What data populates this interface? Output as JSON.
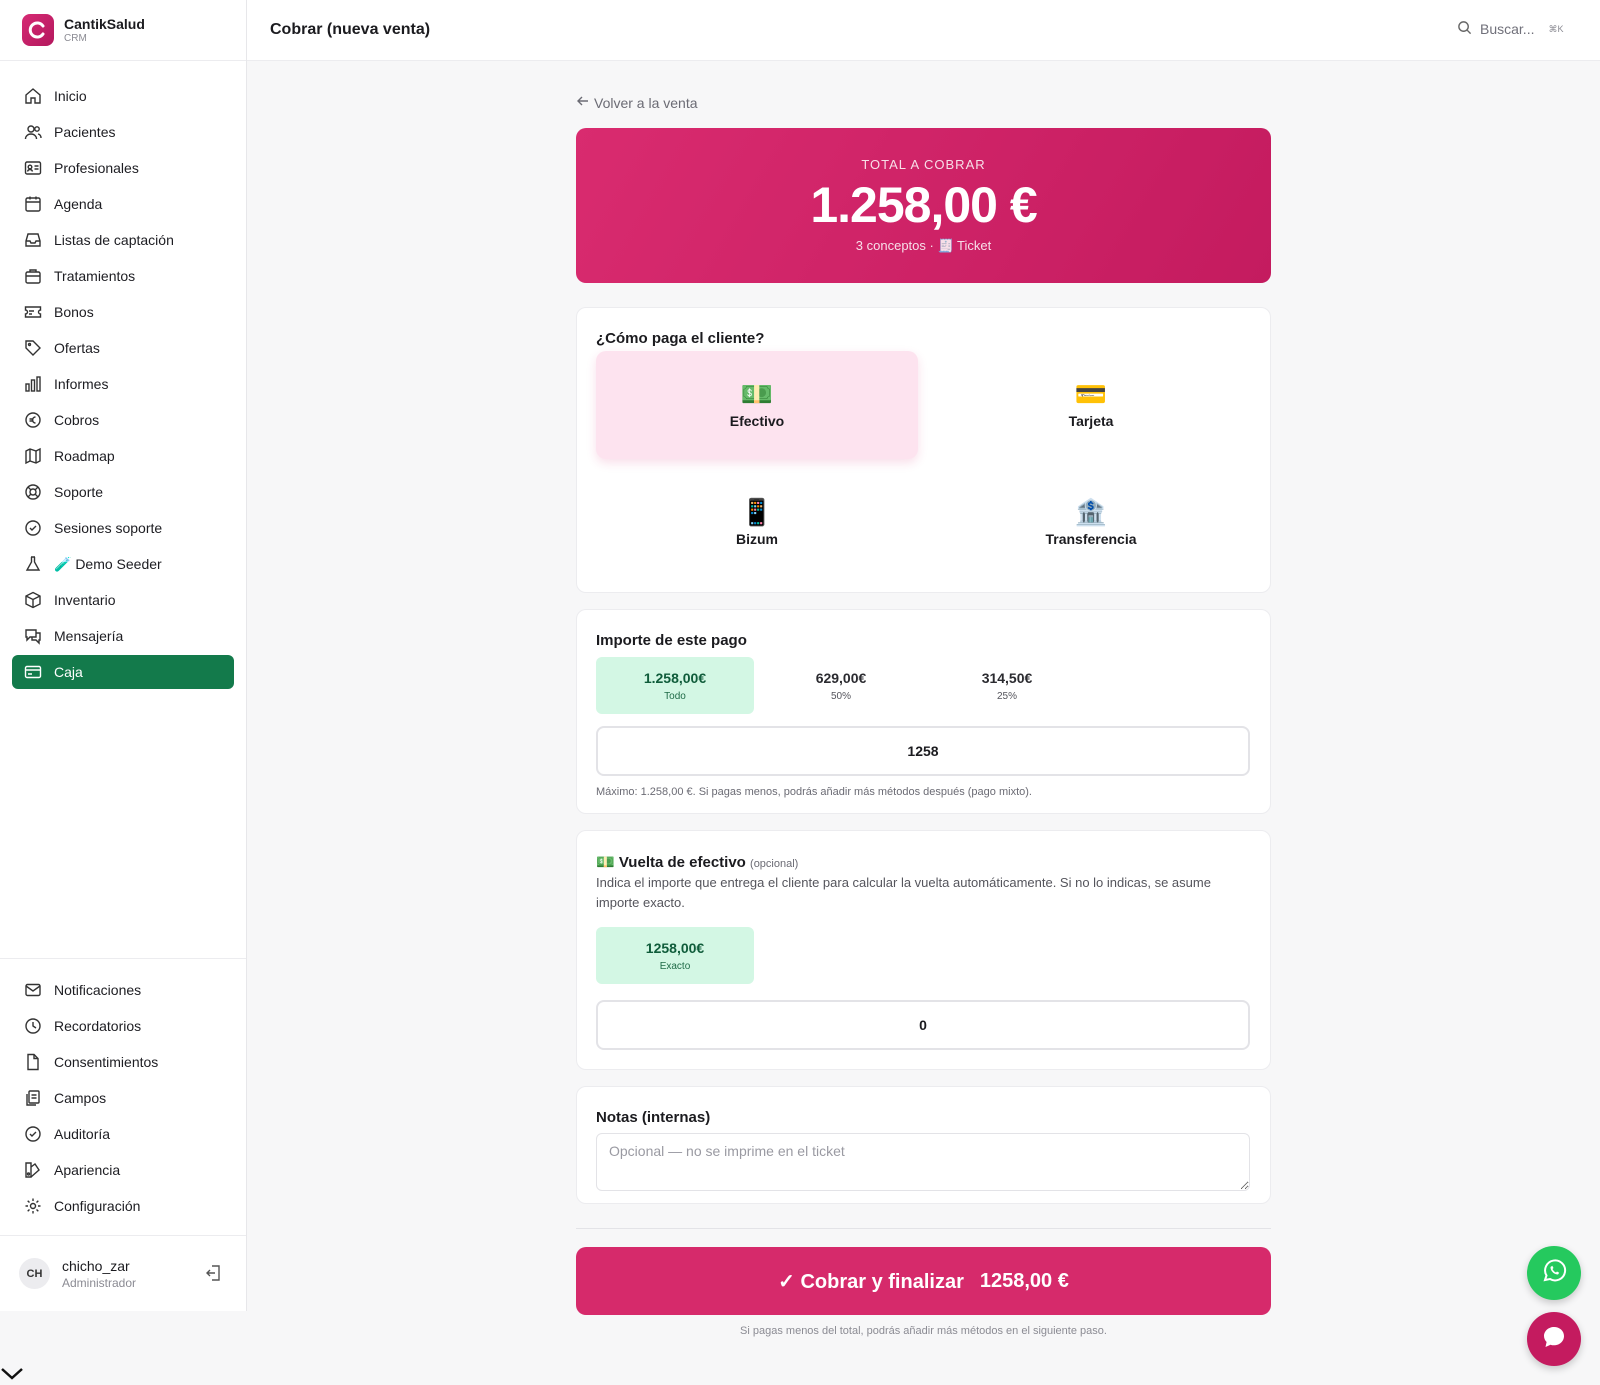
{
  "brand": {
    "name": "CantikSalud",
    "sub": "CRM"
  },
  "sidebar": {
    "items": [
      {
        "label": "Inicio"
      },
      {
        "label": "Pacientes"
      },
      {
        "label": "Profesionales"
      },
      {
        "label": "Agenda"
      },
      {
        "label": "Listas de captación"
      },
      {
        "label": "Tratamientos"
      },
      {
        "label": "Bonos"
      },
      {
        "label": "Ofertas"
      },
      {
        "label": "Informes"
      },
      {
        "label": "Cobros"
      },
      {
        "label": "Roadmap"
      },
      {
        "label": "Soporte"
      },
      {
        "label": "Sesiones soporte"
      },
      {
        "label": "🧪 Demo Seeder"
      },
      {
        "label": "Inventario"
      },
      {
        "label": "Mensajería"
      },
      {
        "label": "Caja"
      }
    ],
    "bottom_items": [
      {
        "label": "Notificaciones"
      },
      {
        "label": "Recordatorios"
      },
      {
        "label": "Consentimientos"
      },
      {
        "label": "Campos"
      },
      {
        "label": "Auditoría"
      },
      {
        "label": "Apariencia"
      },
      {
        "label": "Configuración"
      }
    ],
    "active_color": "#137a4b"
  },
  "user": {
    "initials": "CH",
    "name": "chicho_zar",
    "role": "Administrador"
  },
  "header": {
    "title": "Cobrar (nueva venta)",
    "search_placeholder": "Buscar...",
    "shortcut": "⌘K"
  },
  "back_link": "Volver a la venta",
  "total": {
    "label": "TOTAL A COBRAR",
    "amount": "1.258,00 €",
    "meta": "3 conceptos · 🧾 Ticket",
    "color": "#d62a6b"
  },
  "payment_method": {
    "title": "¿Cómo paga el cliente?",
    "options": [
      {
        "emoji": "💵",
        "label": "Efectivo",
        "selected": true
      },
      {
        "emoji": "💳",
        "label": "Tarjeta",
        "selected": false
      },
      {
        "emoji": "📱",
        "label": "Bizum",
        "selected": false
      },
      {
        "emoji": "🏦",
        "label": "Transferencia",
        "selected": false
      }
    ]
  },
  "amount": {
    "title": "Importe de este pago",
    "chips": [
      {
        "value": "1.258,00€",
        "sub": "Todo",
        "selected": true
      },
      {
        "value": "629,00€",
        "sub": "50%",
        "selected": false
      },
      {
        "value": "314,50€",
        "sub": "25%",
        "selected": false
      }
    ],
    "input_value": "1258",
    "hint": "Máximo: 1.258,00 €. Si pagas menos, podrás añadir más métodos después (pago mixto)."
  },
  "change": {
    "emoji": "💵",
    "title": "Vuelta de efectivo",
    "optional": "(opcional)",
    "description": "Indica el importe que entrega el cliente para calcular la vuelta automáticamente. Si no lo indicas, se asume importe exacto.",
    "chip": {
      "value": "1258,00€",
      "sub": "Exacto"
    },
    "input_value": "0"
  },
  "notes": {
    "title": "Notas (internas)",
    "placeholder": "Opcional — no se imprime en el ticket"
  },
  "submit": {
    "label": "✓ Cobrar y finalizar",
    "amount": "1258,00 €"
  },
  "footnote": "Si pagas menos del total, podrás añadir más métodos en el siguiente paso."
}
